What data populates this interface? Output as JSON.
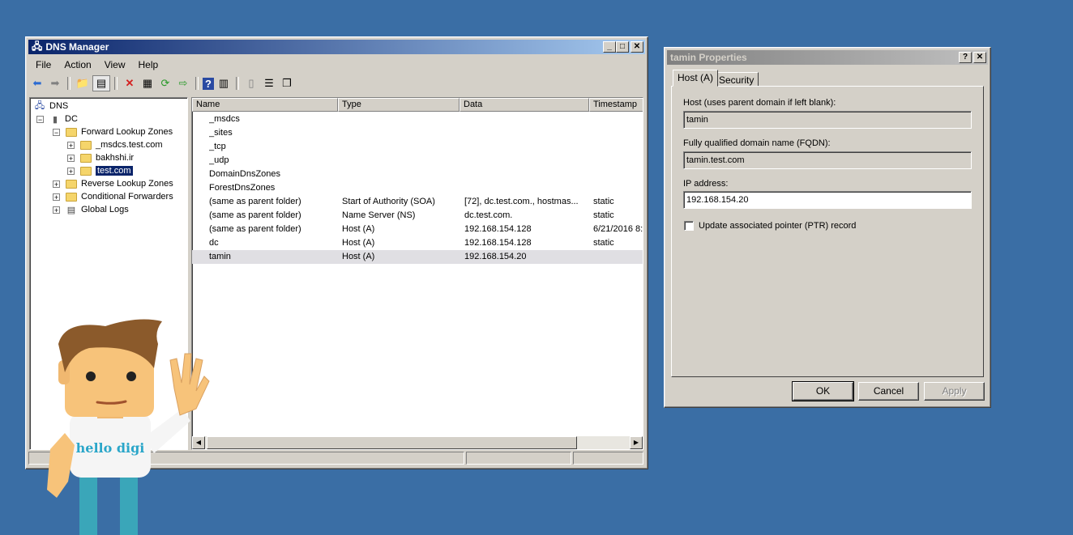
{
  "dns_manager": {
    "title": "DNS Manager",
    "menu": [
      "File",
      "Action",
      "View",
      "Help"
    ],
    "tree": {
      "root": "DNS",
      "server": "DC",
      "forward_zones": "Forward Lookup Zones",
      "zones": [
        "_msdcs.test.com",
        "bakhshi.ir",
        "test.com"
      ],
      "reverse_zones": "Reverse Lookup Zones",
      "conditional_forwarders": "Conditional Forwarders",
      "global_logs": "Global Logs"
    },
    "columns": [
      "Name",
      "Type",
      "Data",
      "Timestamp"
    ],
    "records": [
      {
        "name": "_msdcs",
        "type": "",
        "data": "",
        "timestamp": "",
        "icon": "zone-folder-icon"
      },
      {
        "name": "_sites",
        "type": "",
        "data": "",
        "timestamp": "",
        "icon": "folder-icon"
      },
      {
        "name": "_tcp",
        "type": "",
        "data": "",
        "timestamp": "",
        "icon": "folder-icon"
      },
      {
        "name": "_udp",
        "type": "",
        "data": "",
        "timestamp": "",
        "icon": "folder-icon"
      },
      {
        "name": "DomainDnsZones",
        "type": "",
        "data": "",
        "timestamp": "",
        "icon": "folder-icon"
      },
      {
        "name": "ForestDnsZones",
        "type": "",
        "data": "",
        "timestamp": "",
        "icon": "folder-icon"
      },
      {
        "name": "(same as parent folder)",
        "type": "Start of Authority (SOA)",
        "data": "[72], dc.test.com., hostmas...",
        "timestamp": "static",
        "icon": "record-icon"
      },
      {
        "name": "(same as parent folder)",
        "type": "Name Server (NS)",
        "data": "dc.test.com.",
        "timestamp": "static",
        "icon": "record-icon"
      },
      {
        "name": "(same as parent folder)",
        "type": "Host (A)",
        "data": "192.168.154.128",
        "timestamp": "6/21/2016 8:",
        "icon": "record-icon"
      },
      {
        "name": "dc",
        "type": "Host (A)",
        "data": "192.168.154.128",
        "timestamp": "static",
        "icon": "record-icon"
      },
      {
        "name": "tamin",
        "type": "Host (A)",
        "data": "192.168.154.20",
        "timestamp": "",
        "icon": "record-icon"
      }
    ]
  },
  "properties": {
    "title": "tamin Properties",
    "tabs": [
      "Host (A)",
      "Security"
    ],
    "host_label": "Host (uses parent domain if left blank):",
    "host_value": "tamin",
    "fqdn_label": "Fully qualified domain name (FQDN):",
    "fqdn_value": "tamin.test.com",
    "ip_label": "IP address:",
    "ip_value": "192.168.154.20",
    "ptr_label": "Update associated pointer (PTR) record",
    "ok": "OK",
    "cancel": "Cancel",
    "apply": "Apply"
  },
  "mascot": {
    "shirt_text": "hello digi"
  }
}
